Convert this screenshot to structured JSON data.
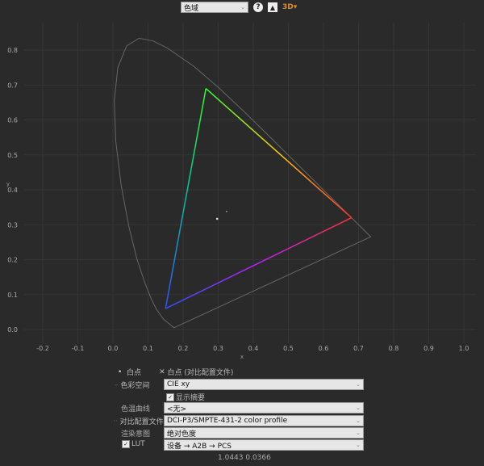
{
  "toolbar": {
    "view_select": "色域",
    "help_icon": "question-icon",
    "image_icon": "image-icon",
    "view3d_icon": "3d-icon",
    "view3d_label": "3D"
  },
  "chart_data": {
    "type": "scatter",
    "xlabel": "x",
    "ylabel": "y",
    "xlim": [
      -0.25,
      1.0
    ],
    "ylim": [
      -0.05,
      0.85
    ],
    "xticks": [
      "-0.2",
      "-0.1",
      "0.0",
      "0.1",
      "0.2",
      "0.3",
      "0.4",
      "0.5",
      "0.6",
      "0.7",
      "0.8",
      "0.9",
      "1.0"
    ],
    "yticks": [
      "0.0",
      "0.1",
      "0.2",
      "0.3",
      "0.4",
      "0.5",
      "0.6",
      "0.7",
      "0.8"
    ],
    "grid": true,
    "gamut": {
      "red": [
        0.68,
        0.32
      ],
      "green": [
        0.265,
        0.69
      ],
      "blue": [
        0.15,
        0.06
      ]
    },
    "white_point": [
      0.297,
      0.317
    ],
    "white_point_reference": [
      0.324,
      0.338
    ],
    "spectral_locus": [
      [
        0.1741,
        0.005
      ],
      [
        0.144,
        0.0297
      ],
      [
        0.1241,
        0.0578
      ],
      [
        0.1096,
        0.0868
      ],
      [
        0.0913,
        0.1327
      ],
      [
        0.0687,
        0.2007
      ],
      [
        0.0454,
        0.295
      ],
      [
        0.0235,
        0.4127
      ],
      [
        0.0082,
        0.5384
      ],
      [
        0.0039,
        0.6548
      ],
      [
        0.0139,
        0.7502
      ],
      [
        0.0389,
        0.812
      ],
      [
        0.0743,
        0.8338
      ],
      [
        0.1142,
        0.8262
      ],
      [
        0.1547,
        0.8059
      ],
      [
        0.2296,
        0.7543
      ],
      [
        0.3016,
        0.6923
      ],
      [
        0.3731,
        0.6245
      ],
      [
        0.4441,
        0.5547
      ],
      [
        0.5125,
        0.4866
      ],
      [
        0.5752,
        0.4242
      ],
      [
        0.627,
        0.3725
      ],
      [
        0.6915,
        0.3083
      ],
      [
        0.7347,
        0.2653
      ]
    ]
  },
  "legend": {
    "white_point": "白点",
    "white_point_ref": "白点 (对比配置文件)"
  },
  "controls": {
    "color_space_label": "色彩空间",
    "color_space": "CIE xy",
    "show_summary": "显示摘要",
    "cct_label": "色温曲线",
    "cct": "<无>",
    "compare_label": "对比配置文件",
    "compare": "DCI-P3/SMPTE-431-2 color profile",
    "intent_label": "渲染意图",
    "intent": "绝对色度",
    "lut_label": "LUT",
    "lut": "设备 → A2B → PCS"
  },
  "readout": "1.0443 0.0366"
}
